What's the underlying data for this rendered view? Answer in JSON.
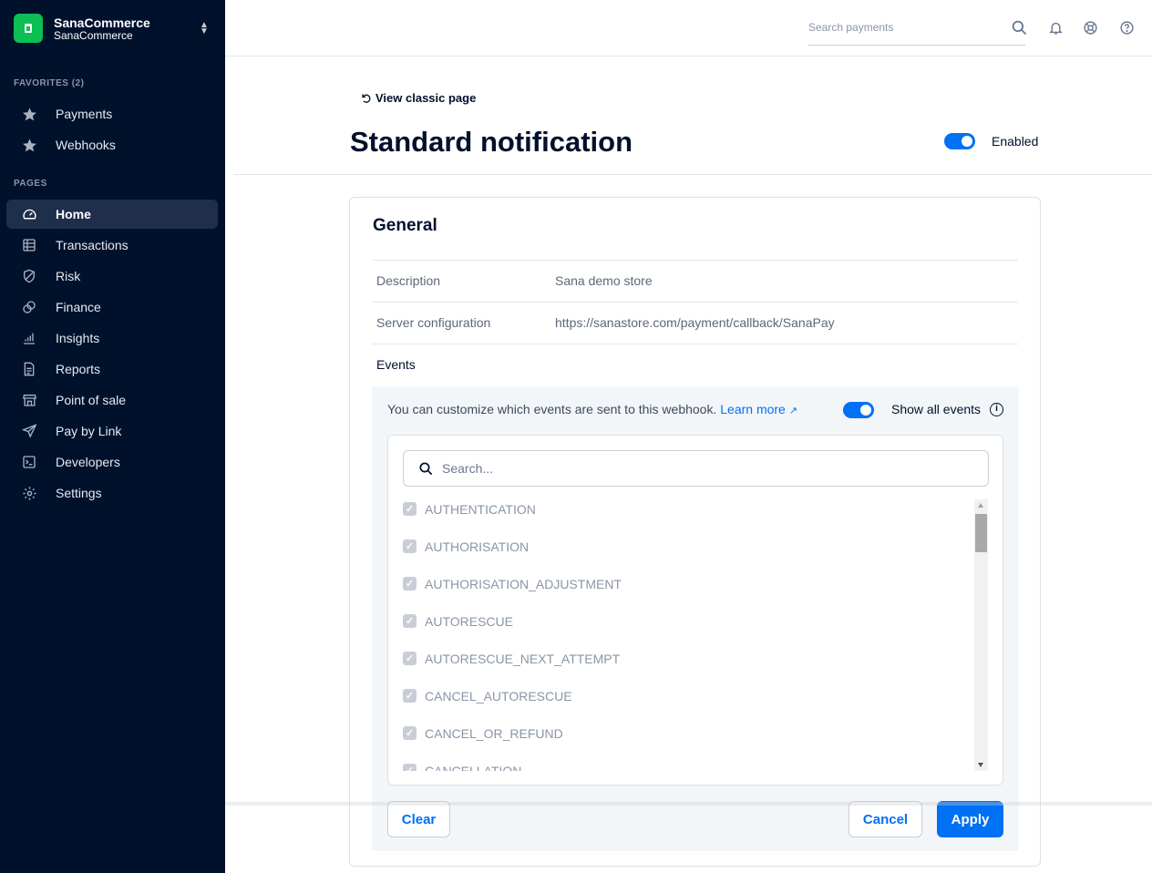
{
  "merchant": {
    "name": "SanaCommerce",
    "sub": "SanaCommerce"
  },
  "sidebar": {
    "favorites_label": "FAVORITES (2)",
    "favorites": [
      {
        "label": "Payments",
        "icon": "star-icon"
      },
      {
        "label": "Webhooks",
        "icon": "star-icon"
      }
    ],
    "pages_label": "PAGES",
    "pages": [
      {
        "label": "Home",
        "icon": "gauge-icon",
        "active": true
      },
      {
        "label": "Transactions",
        "icon": "table-icon"
      },
      {
        "label": "Risk",
        "icon": "shield-icon"
      },
      {
        "label": "Finance",
        "icon": "coins-icon"
      },
      {
        "label": "Insights",
        "icon": "bar-chart-icon"
      },
      {
        "label": "Reports",
        "icon": "document-icon"
      },
      {
        "label": "Point of sale",
        "icon": "store-icon"
      },
      {
        "label": "Pay by Link",
        "icon": "paper-plane-icon"
      },
      {
        "label": "Developers",
        "icon": "terminal-icon"
      },
      {
        "label": "Settings",
        "icon": "gear-icon"
      }
    ]
  },
  "topbar": {
    "search_placeholder": "Search payments"
  },
  "header": {
    "classic_link": "View classic page",
    "title": "Standard notification",
    "enabled_label": "Enabled",
    "enabled": true
  },
  "general": {
    "title": "General",
    "rows": [
      {
        "label": "Description",
        "value": "Sana demo store"
      },
      {
        "label": "Server configuration",
        "value": "https://sanastore.com/payment/callback/SanaPay"
      }
    ]
  },
  "events": {
    "label": "Events",
    "info_text": "You can customize which events are sent to this webhook.",
    "learn_more": "Learn more",
    "show_all_label": "Show all events",
    "show_all": true,
    "search_placeholder": "Search...",
    "items": [
      "AUTHENTICATION",
      "AUTHORISATION",
      "AUTHORISATION_ADJUSTMENT",
      "AUTORESCUE",
      "AUTORESCUE_NEXT_ATTEMPT",
      "CANCEL_AUTORESCUE",
      "CANCEL_OR_REFUND",
      "CANCELLATION"
    ]
  },
  "buttons": {
    "clear": "Clear",
    "cancel": "Cancel",
    "apply": "Apply"
  },
  "colors": {
    "sidebar_bg": "#00112c",
    "accent": "#0070f5",
    "brand_green": "#0abf53"
  }
}
